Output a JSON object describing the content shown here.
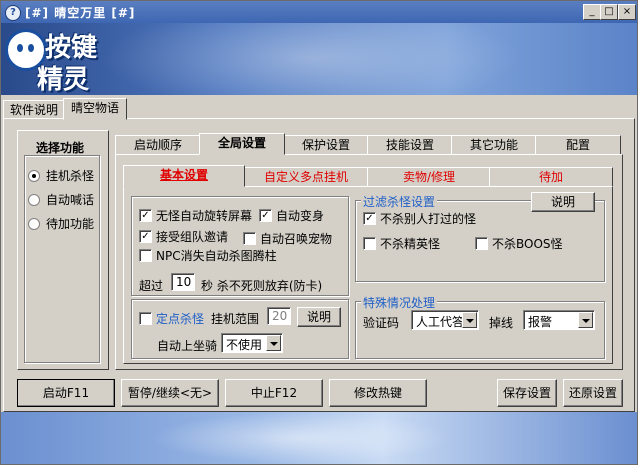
{
  "window": {
    "title": "[#] 晴空万里 [#]",
    "minimize": "_",
    "maximize": "□",
    "close": "×"
  },
  "logo": {
    "line1": "按键",
    "line2": "精灵"
  },
  "top_tabs": [
    {
      "label": "软件说明"
    },
    {
      "label": "晴空物语"
    }
  ],
  "function_panel": {
    "title": "选择功能",
    "options": [
      {
        "label": "挂机杀怪",
        "selected": true
      },
      {
        "label": "自动喊话",
        "selected": false
      },
      {
        "label": "待加功能",
        "selected": false
      }
    ]
  },
  "main_tabs": [
    {
      "label": "启动顺序"
    },
    {
      "label": "全局设置"
    },
    {
      "label": "保护设置"
    },
    {
      "label": "技能设置"
    },
    {
      "label": "其它功能"
    },
    {
      "label": "配置"
    }
  ],
  "sub_tabs": [
    {
      "label": "基本设置"
    },
    {
      "label": "自定义多点挂机"
    },
    {
      "label": "卖物/修理"
    },
    {
      "label": "待加"
    }
  ],
  "basic": {
    "cb1": {
      "label": "无怪自动旋转屏幕",
      "checked": true
    },
    "cb2": {
      "label": "自动变身",
      "checked": true
    },
    "cb3": {
      "label": "接受组队邀请",
      "checked": true
    },
    "cb4": {
      "label": "自动召唤宠物",
      "checked": false
    },
    "cb5": {
      "label": "NPC消失自动杀图腾柱",
      "checked": false
    },
    "timeout_prefix": "超过",
    "timeout_value": "10",
    "timeout_suffix": "秒 杀不死则放弃(防卡)"
  },
  "fixed": {
    "cb_label": "定点杀怪",
    "range_label": "挂机范围",
    "range_value": "20",
    "explain_button": "说明",
    "mount_label": "自动上坐骑",
    "mount_value": "不使用"
  },
  "filter": {
    "title": "过滤杀怪设置",
    "explain_button": "说明",
    "cb1": {
      "label": "不杀别人打过的怪",
      "checked": true
    },
    "cb2": {
      "label": "不杀精英怪",
      "checked": false
    },
    "cb3": {
      "label": "不杀BOOS怪",
      "checked": false
    }
  },
  "special": {
    "title": "特殊情况处理",
    "captcha_label": "验证码",
    "captcha_value": "人工代答",
    "drop_label": "掉线",
    "drop_value": "报警"
  },
  "bottom_buttons": {
    "start": "启动F11",
    "pause": "暂停/继续<无>",
    "stop": "中止F12",
    "hotkey": "修改热键",
    "save": "保存设置",
    "restore": "还原设置"
  },
  "colors": {
    "accent_red": "#e00000",
    "accent_blue": "#1e5fc8",
    "face": "#d4d0c8",
    "title_bar": "#3e67b3"
  }
}
